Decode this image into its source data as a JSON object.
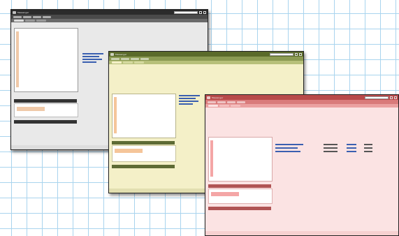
{
  "windows": [
    {
      "id": "black",
      "title": "Messenger",
      "status": "",
      "colors": {
        "title": "#2b2b2b",
        "toolbar": "#4a4a4a",
        "tabs": "#6a6a6a",
        "body": "#e9e9e9",
        "panel": "#ffffff",
        "accent": "#f0c9a8",
        "link": "#3a5fb0",
        "dark": "#333333"
      }
    },
    {
      "id": "olive",
      "title": "Messenger",
      "status": "",
      "colors": {
        "title": "#5a6a2a",
        "toolbar": "#8b9a52",
        "tabs": "#b7c07a",
        "body": "#f4f0c8",
        "panel": "#ffffff",
        "accent": "#f5c59a",
        "link": "#3a5fb0",
        "dark": "#5e6b35"
      }
    },
    {
      "id": "pink",
      "title": "Messenger",
      "status": "",
      "colors": {
        "title": "#b84a4a",
        "toolbar": "#d97a7a",
        "tabs": "#eba0a0",
        "body": "#fbe3e3",
        "panel": "#ffffff",
        "accent": "#f4a6a6",
        "link": "#3a5fb0",
        "dark": "#b05454"
      }
    }
  ]
}
